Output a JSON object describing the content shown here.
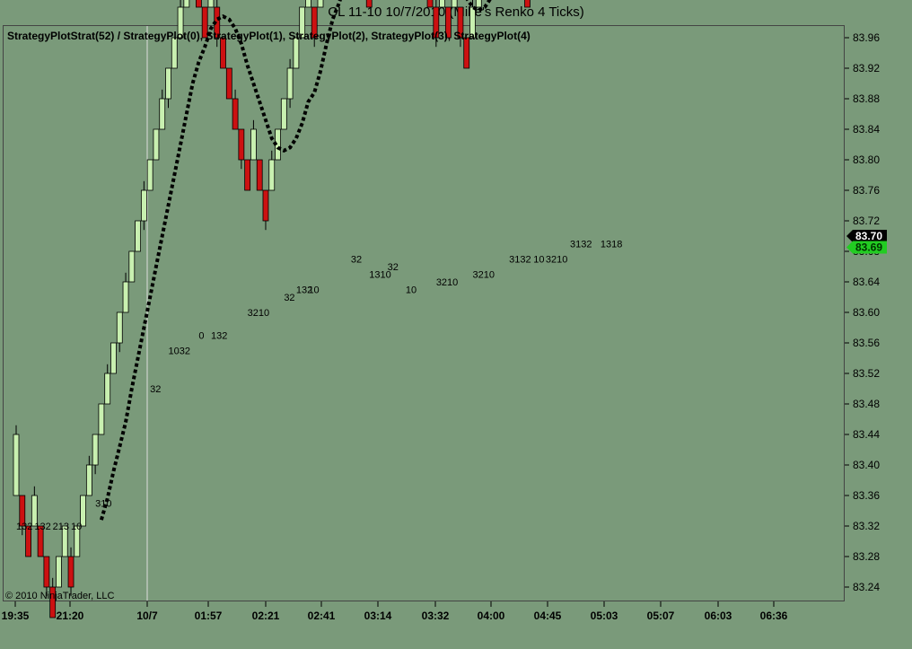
{
  "title": "CL 11-10  10/7/2010 (Mike's Renko 4 Ticks)",
  "subtitle": "StrategyPlotStrat(52)  /  StrategyPlot(0),  StrategyPlot(1),  StrategyPlot(2),  StrategyPlot(3),  StrategyPlot(4)",
  "copyright": "© 2010 NinjaTrader, LLC",
  "colors": {
    "background": "#7a9a7a",
    "up": "#c8f0b0",
    "down": "#cc1111",
    "wick": "#000000",
    "last_badge": "#000000",
    "strategy_badge": "#22cc22"
  },
  "chart_data": {
    "type": "candlestick",
    "brick_size": 0.04,
    "ylim": [
      83.22,
      83.98
    ],
    "y_ticks": [
      83.96,
      83.92,
      83.88,
      83.84,
      83.8,
      83.76,
      83.72,
      83.68,
      83.64,
      83.6,
      83.56,
      83.52,
      83.48,
      83.44,
      83.4,
      83.36,
      83.32,
      83.28,
      83.24
    ],
    "x_ticks": [
      "19:35",
      "21:20",
      "10/7",
      "01:57",
      "02:21",
      "02:41",
      "03:14",
      "03:32",
      "04:00",
      "04:45",
      "05:03",
      "05:07",
      "06:03",
      "06:36"
    ],
    "bricks": [
      "u",
      "d",
      "d",
      "u",
      "d",
      "d",
      "d",
      "u",
      "u",
      "d",
      "u",
      "u",
      "u",
      "u",
      "u",
      "u",
      "u",
      "u",
      "u",
      "u",
      "u",
      "u",
      "u",
      "u",
      "u",
      "u",
      "u",
      "u",
      "u",
      "u",
      "d",
      "d",
      "u",
      "d",
      "d",
      "d",
      "d",
      "d",
      "d",
      "u",
      "d",
      "d",
      "u",
      "u",
      "u",
      "u",
      "u",
      "u",
      "u",
      "d",
      "u",
      "u",
      "u",
      "d",
      "u",
      "d",
      "u",
      "d",
      "d",
      "u",
      "u",
      "u",
      "u",
      "u",
      "d",
      "d",
      "d",
      "d",
      "d",
      "d",
      "u",
      "d",
      "u",
      "d",
      "d",
      "u",
      "u",
      "u",
      "u",
      "u",
      "d",
      "d",
      "u",
      "d",
      "d",
      "u",
      "u",
      "u",
      "u",
      "u",
      "d",
      "d",
      "u",
      "u",
      "u",
      "u",
      "u",
      "d",
      "d",
      "d",
      "d",
      "u",
      "u",
      "u",
      "u",
      "u",
      "d",
      "d",
      "u",
      "u",
      "d",
      "d",
      "u",
      "d",
      "u",
      "u",
      "u",
      "u",
      "d",
      "d",
      "d",
      "u",
      "u",
      "u",
      "u",
      "d",
      "d",
      "d",
      "d",
      "d",
      "d",
      "u",
      "u"
    ],
    "last_price": "83.70",
    "strategy_value": "83.69",
    "strategy_plot_labels": [
      {
        "text": "132",
        "x": 0,
        "y": 83.32
      },
      {
        "text": "132",
        "x": 3,
        "y": 83.32
      },
      {
        "text": "213",
        "x": 6,
        "y": 83.32
      },
      {
        "text": "10",
        "x": 9,
        "y": 83.32
      },
      {
        "text": "310",
        "x": 13,
        "y": 83.35
      },
      {
        "text": "32",
        "x": 22,
        "y": 83.5
      },
      {
        "text": "1032",
        "x": 25,
        "y": 83.55
      },
      {
        "text": "0",
        "x": 30,
        "y": 83.57
      },
      {
        "text": "132",
        "x": 32,
        "y": 83.57
      },
      {
        "text": "3210",
        "x": 38,
        "y": 83.6
      },
      {
        "text": "32",
        "x": 44,
        "y": 83.62
      },
      {
        "text": "132",
        "x": 46,
        "y": 83.63
      },
      {
        "text": "10",
        "x": 48,
        "y": 83.63
      },
      {
        "text": "32",
        "x": 55,
        "y": 83.67
      },
      {
        "text": "1310",
        "x": 58,
        "y": 83.65
      },
      {
        "text": "32",
        "x": 61,
        "y": 83.66
      },
      {
        "text": "10",
        "x": 64,
        "y": 83.63
      },
      {
        "text": "3210",
        "x": 69,
        "y": 83.64
      },
      {
        "text": "3210",
        "x": 75,
        "y": 83.65
      },
      {
        "text": "3132",
        "x": 81,
        "y": 83.67
      },
      {
        "text": "10",
        "x": 85,
        "y": 83.67
      },
      {
        "text": "3210",
        "x": 87,
        "y": 83.67
      },
      {
        "text": "3132",
        "x": 91,
        "y": 83.69
      },
      {
        "text": "1318",
        "x": 96,
        "y": 83.69
      }
    ]
  }
}
